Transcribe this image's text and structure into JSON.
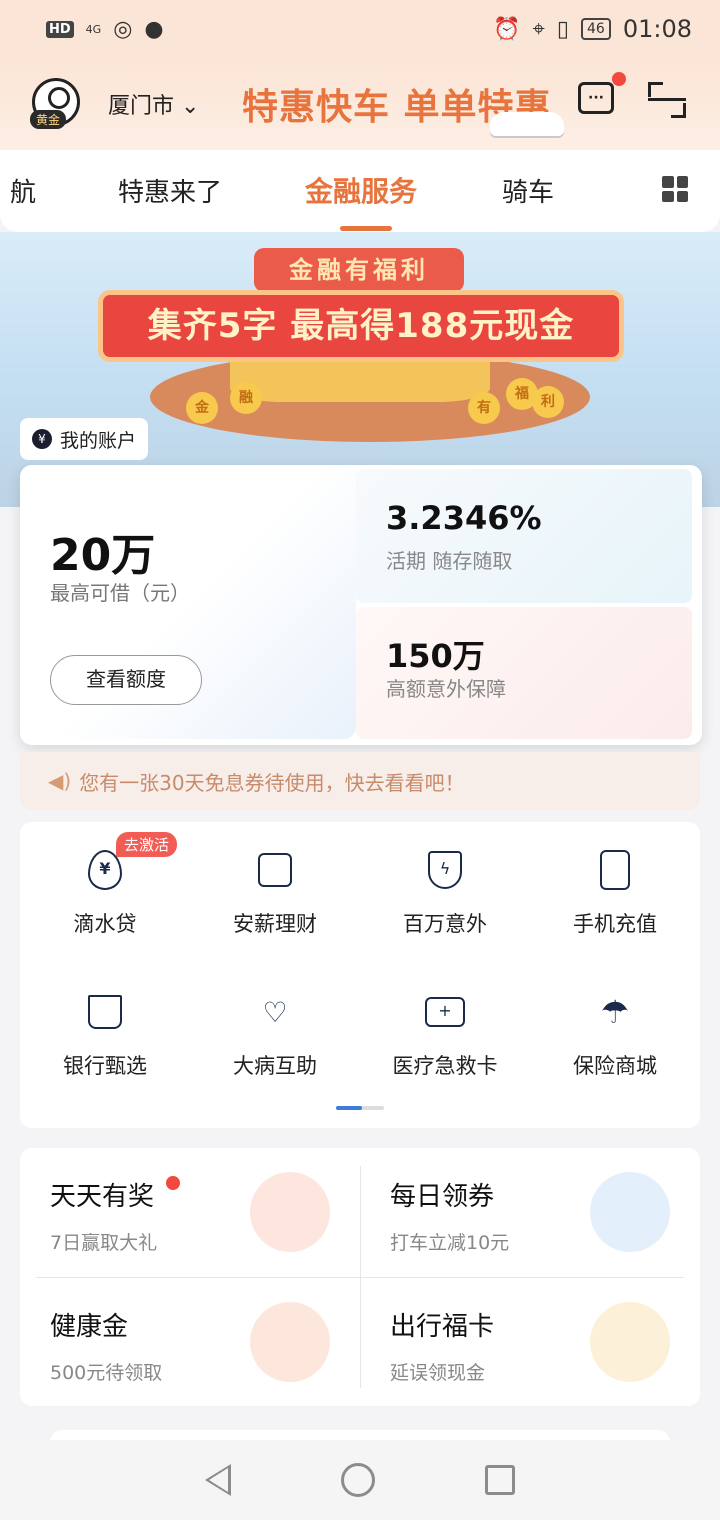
{
  "status_bar": {
    "hd": "HD",
    "signal": "4G",
    "battery": "46",
    "time": "01:08"
  },
  "header": {
    "city": "厦门市",
    "slogan": "特惠快车 单单特惠",
    "member_level": "黄金"
  },
  "tabs": [
    {
      "label": "航"
    },
    {
      "label": "特惠来了"
    },
    {
      "label": "金融服务",
      "active": true
    },
    {
      "label": "骑车"
    }
  ],
  "banner": {
    "small_title": "金融有福利",
    "main_title": "集齐5字 最高得188元现金",
    "coins": [
      "金",
      "融",
      "有",
      "福",
      "利"
    ]
  },
  "account": {
    "label": "我的账户",
    "loan_amount": "20万",
    "loan_label": "最高可借（元）",
    "loan_button": "查看额度",
    "rate_value": "3.2346%",
    "rate_label": "活期 随存随取",
    "insure_value": "150万",
    "insure_label": "高额意外保障"
  },
  "notice": {
    "text": "您有一张30天免息券待使用，快去看看吧！"
  },
  "services": {
    "items": [
      {
        "label": "滴水贷",
        "icon": "water-drop-yen-icon",
        "badge": "去激活"
      },
      {
        "label": "安薪理财",
        "icon": "chart-trend-icon"
      },
      {
        "label": "百万意外",
        "icon": "shield-bolt-icon"
      },
      {
        "label": "手机充值",
        "icon": "phone-icon"
      },
      {
        "label": "银行甄选",
        "icon": "crown-diamond-icon"
      },
      {
        "label": "大病互助",
        "icon": "heart-hands-icon"
      },
      {
        "label": "医疗急救卡",
        "icon": "medical-card-icon"
      },
      {
        "label": "保险商城",
        "icon": "umbrella-icon"
      }
    ]
  },
  "rewards": [
    {
      "title": "天天有奖",
      "subtitle": "7日赢取大礼",
      "icon": "gift-icon",
      "dot": true,
      "color": "#f0533f"
    },
    {
      "title": "每日领券",
      "subtitle": "打车立减10元",
      "icon": "coupon-envelope-icon",
      "color": "#f3b54a"
    },
    {
      "title": "健康金",
      "subtitle": "500元待领取",
      "icon": "shield-coin-icon",
      "color": "#f08a4b"
    },
    {
      "title": "出行福卡",
      "subtitle": "延误领现金",
      "icon": "wallet-clock-icon",
      "color": "#f3b24a"
    }
  ],
  "colors": {
    "accent": "#e8743d",
    "badge_red": "#f25c54",
    "dark_icon": "#1b2a4a"
  }
}
